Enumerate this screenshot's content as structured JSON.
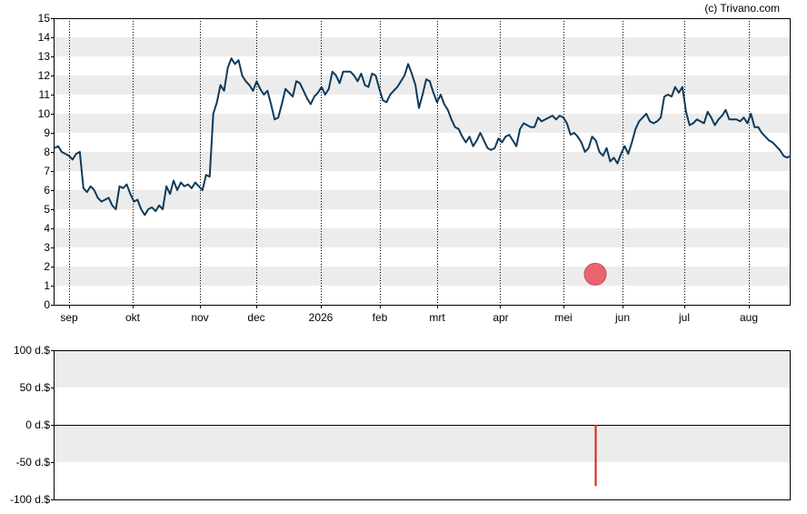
{
  "credit": "(c) Trivano.com",
  "colors": {
    "line": "#0e3a5a",
    "stripe": "#ececec",
    "marker": "#e8656f",
    "volume_bar": "#dd1a1a"
  },
  "chart_data": [
    {
      "type": "line",
      "title": "",
      "xlabel": "",
      "ylabel": "",
      "ylim": [
        0,
        15
      ],
      "y_ticks": [
        "0",
        "1",
        "2",
        "3",
        "4",
        "5",
        "6",
        "7",
        "8",
        "9",
        "10",
        "11",
        "12",
        "13",
        "14",
        "15"
      ],
      "x_ticks": [
        "sep",
        "okt",
        "nov",
        "dec",
        "2026",
        "feb",
        "mrt",
        "apr",
        "mei",
        "jun",
        "jul",
        "aug"
      ],
      "grid": "alternating horizontal stripes, dotted vertical lines at month starts",
      "series": [
        {
          "values": [
            8.2,
            8.3,
            8.0,
            7.9,
            7.8,
            7.6,
            7.9,
            8.0,
            6.1,
            5.9,
            6.2,
            6.0,
            5.6,
            5.4,
            5.5,
            5.6,
            5.2,
            5.0,
            6.2,
            6.1,
            6.3,
            5.8,
            5.4,
            5.5,
            5.0,
            4.7,
            5.0,
            5.1,
            4.9,
            5.2,
            5.0,
            6.2,
            5.8,
            6.5,
            6.0,
            6.4,
            6.2,
            6.3,
            6.1,
            6.4,
            6.2,
            6.0,
            6.8,
            6.7,
            10.0,
            10.6,
            11.5,
            11.2,
            12.4,
            12.9,
            12.6,
            12.8,
            12.0,
            11.7,
            11.5,
            11.2,
            11.7,
            11.3,
            11.0,
            11.2,
            10.5,
            9.7,
            9.8,
            10.5,
            11.3,
            11.1,
            10.9,
            11.7,
            11.6,
            11.2,
            10.8,
            10.5,
            10.9,
            11.1,
            11.4,
            11.0,
            11.3,
            12.2,
            12.0,
            11.6,
            12.2,
            12.2,
            12.2,
            12.0,
            11.7,
            12.1,
            11.5,
            11.4,
            12.1,
            12.0,
            11.3,
            10.7,
            10.6,
            11.0,
            11.2,
            11.4,
            11.7,
            12.0,
            12.6,
            12.1,
            11.5,
            10.3,
            11.0,
            11.8,
            11.7,
            11.1,
            10.6,
            11.0,
            10.5,
            10.2,
            9.7,
            9.3,
            9.2,
            8.8,
            8.5,
            8.8,
            8.3,
            8.6,
            9.0,
            8.6,
            8.2,
            8.1,
            8.2,
            8.7,
            8.5,
            8.8,
            8.9,
            8.6,
            8.3,
            9.2,
            9.5,
            9.4,
            9.3,
            9.3,
            9.8,
            9.6,
            9.7,
            9.8,
            9.9,
            9.7,
            9.9,
            9.8,
            9.5,
            8.9,
            9.0,
            8.8,
            8.5,
            8.0,
            8.2,
            8.8,
            8.6,
            8.0,
            7.8,
            8.2,
            7.5,
            7.7,
            7.4,
            7.9,
            8.3,
            7.9,
            8.5,
            9.2,
            9.6,
            9.8,
            10.0,
            9.6,
            9.5,
            9.6,
            9.8,
            10.9,
            11.0,
            10.9,
            11.4,
            11.1,
            11.4,
            10.1,
            9.4,
            9.5,
            9.7,
            9.6,
            9.5,
            10.1,
            9.8,
            9.4,
            9.7,
            9.9,
            10.2,
            9.7,
            9.7,
            9.7,
            9.6,
            9.8,
            9.5,
            10.0,
            9.3,
            9.3,
            9.0,
            8.8,
            8.6,
            8.5,
            8.3,
            8.1,
            7.8,
            7.7,
            7.8
          ],
          "color": "#0e3a5a"
        }
      ],
      "markers": [
        {
          "x": "mei",
          "y": 1.6
        }
      ]
    },
    {
      "type": "bar",
      "title": "",
      "ylim": [
        -100,
        100
      ],
      "y_ticks": [
        "100 d.$",
        "50 d.$",
        "0 d.$",
        "-50 d.$",
        "-100 d.$"
      ],
      "bars": [
        {
          "x": "mei",
          "value": -82
        }
      ]
    }
  ]
}
